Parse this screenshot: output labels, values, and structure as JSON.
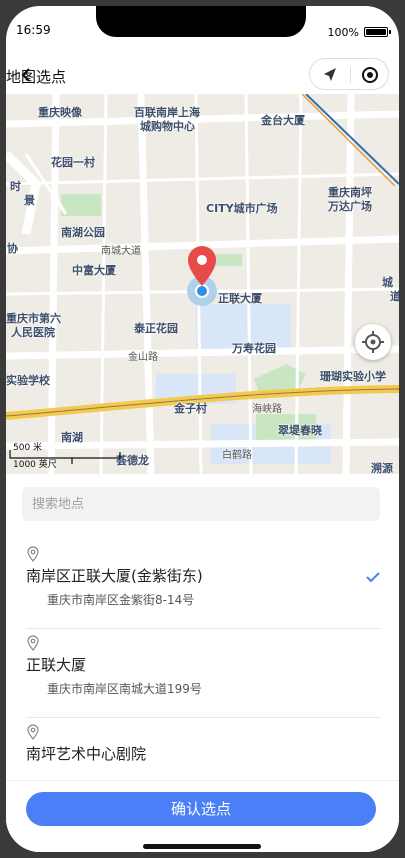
{
  "status": {
    "time": "16:59",
    "battery": "100%",
    "battery_level": 1.0
  },
  "nav": {
    "title": "地图选点",
    "back_icon": "back-arrow-icon",
    "capsule_icons": [
      "location-arrow-icon",
      "target-icon"
    ]
  },
  "map": {
    "labels": [
      "重庆映像",
      "百联南岸上海",
      "城购物中心",
      "金台大厦",
      "花园一村",
      "CITY城市广场",
      "重庆南坪",
      "万达广场",
      "南湖公园",
      "中富大厦",
      "正联大厦",
      "泰正花园",
      "重庆市第六",
      "人民医院",
      "万寿花园",
      "珊瑚实验小学",
      "实验学校",
      "金子村",
      "翠堤春晓",
      "南湖",
      "溯源",
      "荟德龙",
      "协",
      "时",
      "景",
      "城",
      "道"
    ],
    "roads": [
      "南城大道",
      "金山路",
      "海峡路",
      "白鹤路"
    ],
    "scale": {
      "top": "500 米",
      "bottom": "1000 英尺"
    },
    "locate_icon": "crosshair-icon"
  },
  "search": {
    "placeholder": "搜索地点"
  },
  "places": [
    {
      "name": "南岸区正联大厦(金紫街东)",
      "address": "重庆市南岸区金紫街8-14号",
      "selected": true
    },
    {
      "name": "正联大厦",
      "address": "重庆市南岸区南城大道199号",
      "selected": false
    },
    {
      "name": "南坪艺术中心剧院",
      "address": "",
      "selected": false
    }
  ],
  "footer": {
    "confirm_label": "确认选点"
  },
  "colors": {
    "accent": "#4a7ff7",
    "marker": "#e84a4a"
  }
}
